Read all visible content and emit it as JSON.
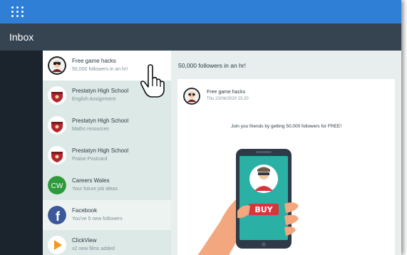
{
  "header": {
    "apps_icon": "grid-dots-icon",
    "title": "Inbox"
  },
  "messages": [
    {
      "title": "Free game hacks",
      "subtitle": "50,000 followers in an hr!",
      "avatar": "hacker-avatar-icon"
    },
    {
      "title": "Prestatyn High School",
      "subtitle": "English Assignment",
      "avatar": "school-crest-icon"
    },
    {
      "title": "Prestatyn High School",
      "subtitle": "Maths resources",
      "avatar": "school-crest-icon"
    },
    {
      "title": "Prestatyn High School",
      "subtitle": "Praise Postcard",
      "avatar": "school-crest-icon"
    },
    {
      "title": "Careers Wales",
      "subtitle": "Your future job ideas",
      "avatar": "careers-wales-logo-icon",
      "logo_text": "CW"
    },
    {
      "title": "Facebook",
      "subtitle": "You've 5 new followers",
      "avatar": "facebook-logo-icon",
      "logo_text": "f"
    },
    {
      "title": "ClickView",
      "subtitle": "x2 new films added",
      "avatar": "clickview-play-icon"
    }
  ],
  "reading_pane": {
    "subject": "50,000 followers in an hr!",
    "from_name": "Free game hacks",
    "date": "Thu 22/04/2020 23.20",
    "body": "Join you friends by getting 50,000 followers for FREE!",
    "image_button_text": "BUY"
  },
  "colors": {
    "topbar": "#2f7fd6",
    "titlebar": "#364452",
    "list_bg": "#dde9e6",
    "crest_red": "#b3262d",
    "careers_green": "#2e9a3b",
    "facebook_blue": "#3b5998",
    "clickview_orange": "#f39a1e",
    "phone_teal": "#2bb0a6",
    "buy_red": "#d9343c",
    "skin": "#f2a77e"
  }
}
